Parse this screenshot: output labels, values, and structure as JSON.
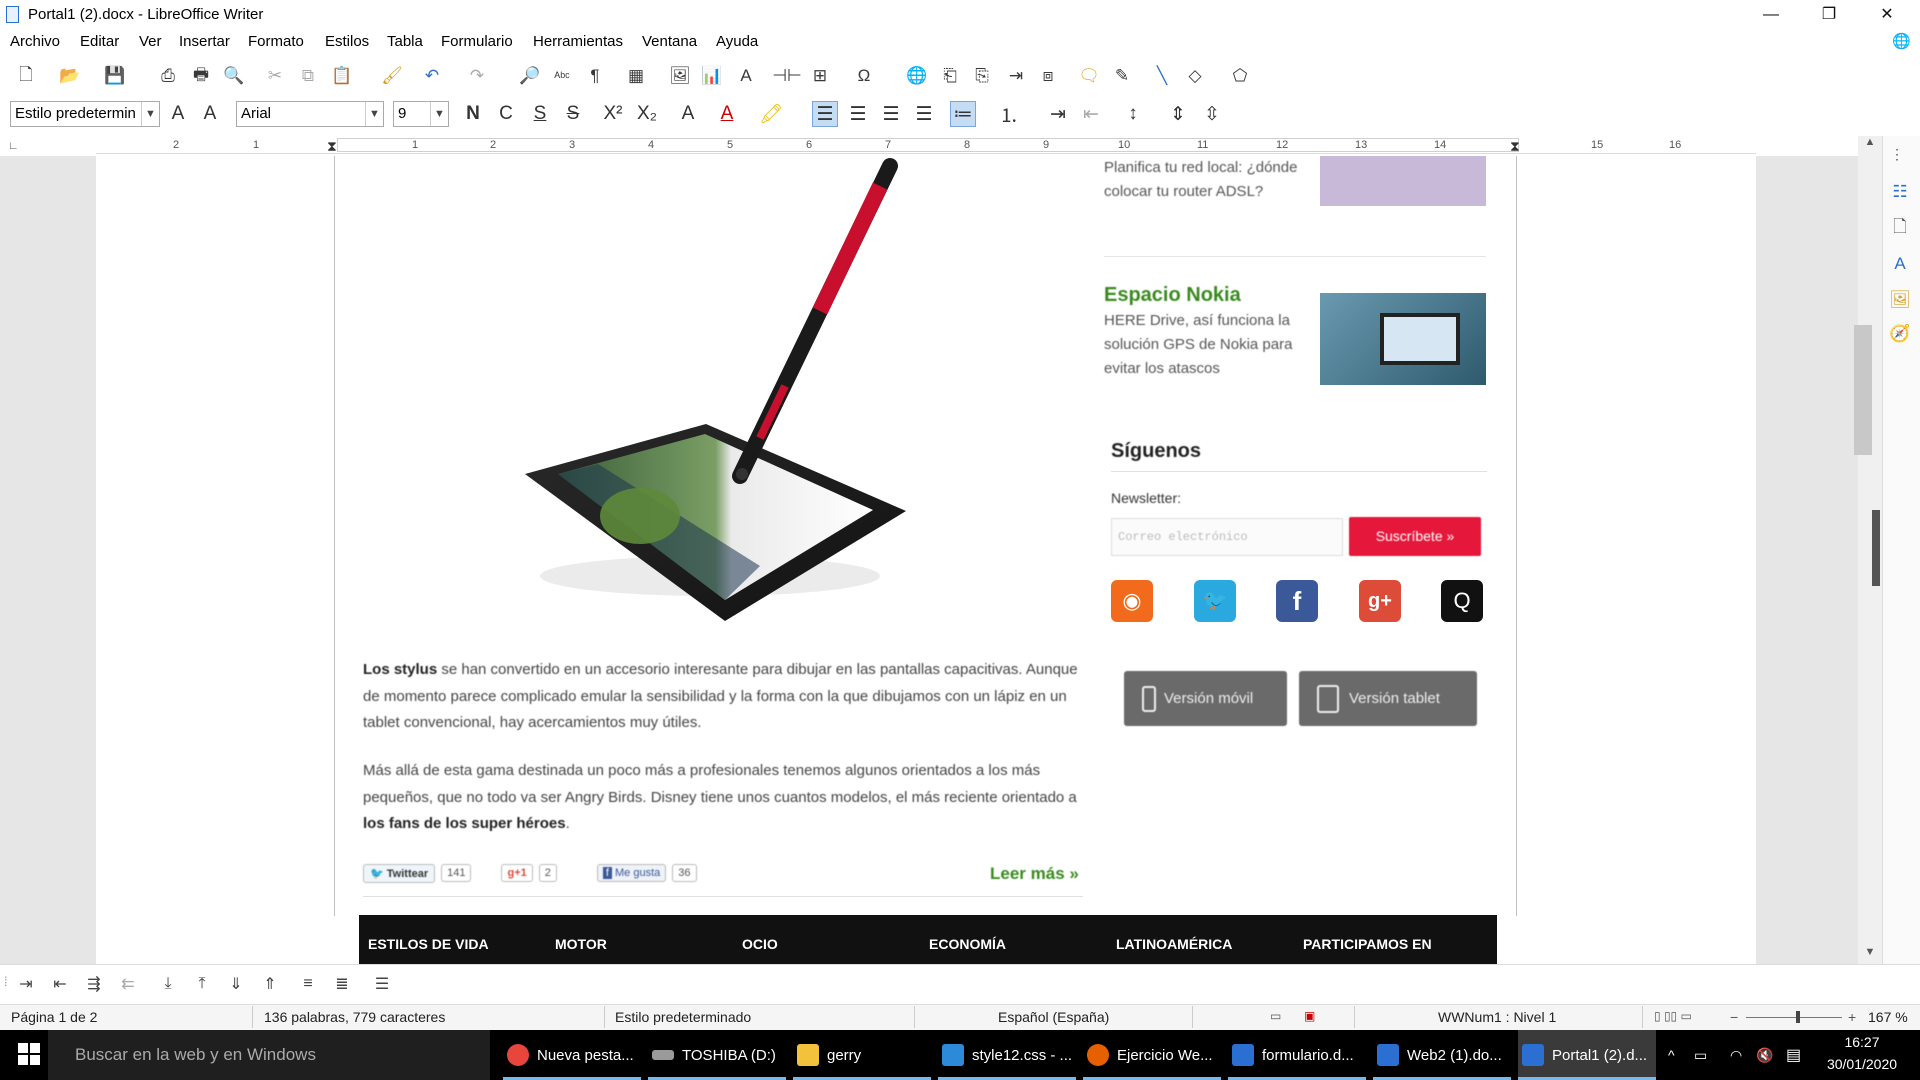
{
  "window": {
    "title": "Portal1 (2).docx - LibreOffice Writer"
  },
  "window_buttons": {
    "minimize": "—",
    "restore": "❐",
    "close": "✕"
  },
  "menu": [
    "Archivo",
    "Editar",
    "Ver",
    "Insertar",
    "Formato",
    "Estilos",
    "Tabla",
    "Formulario",
    "Herramientas",
    "Ventana",
    "Ayuda"
  ],
  "format_toolbar": {
    "paragraph_style": "Estilo predetermin",
    "font_name": "Arial",
    "font_size": "9",
    "bold": "N",
    "italic": "C",
    "underline": "S",
    "strike": "S",
    "superscript": "X²",
    "subscript": "X₂"
  },
  "ruler": {
    "numbers": [
      "2",
      "1",
      "1",
      "2",
      "3",
      "4",
      "5",
      "6",
      "7",
      "8",
      "9",
      "10",
      "11",
      "12",
      "13",
      "14",
      "15",
      "16",
      "17"
    ]
  },
  "document": {
    "sidebar_top": {
      "text": "Planifica tu red local: ¿dónde colocar tu router ADSL?"
    },
    "nokia": {
      "title": "Espacio Nokia",
      "desc": "HERE Drive, así funciona la solución GPS de Nokia para evitar los atascos"
    },
    "siguenos": {
      "title": "Síguenos",
      "newsletter": "Newsletter:",
      "email_placeholder": "Correo electrónico",
      "subscribe": "Suscríbete »"
    },
    "social": [
      {
        "name": "rss",
        "color": "#f26a1b",
        "glyph": "◉"
      },
      {
        "name": "twitter",
        "color": "#2aa9e0",
        "glyph": "🐦"
      },
      {
        "name": "facebook",
        "color": "#3b5998",
        "glyph": "f"
      },
      {
        "name": "google-plus",
        "color": "#dd4b39",
        "glyph": "g+"
      },
      {
        "name": "other",
        "color": "#111111",
        "glyph": "Q"
      }
    ],
    "version_mobile": "Versión móvil",
    "version_tablet": "Versión tablet",
    "paragraph1_bold": "Los stylus",
    "paragraph1_rest": " se han convertido en un accesorio interesante para dibujar en las pantallas capacitivas. Aunque de momento parece complicado emular la sensibilidad y la forma con la que dibujamos con un lápiz en un tablet convencional, hay acercamientos muy útiles.",
    "paragraph2_start": "Más allá de esta gama destinada un poco más a profesionales tenemos algunos orientados a los más pequeños, que no todo va ser Angry Birds. Disney tiene unos cuantos modelos, el más reciente orientado a ",
    "paragraph2_bold": "los fans de los super héroes",
    "paragraph2_end": ".",
    "share": {
      "twitter": "Twittear",
      "twitter_count": "141",
      "gplus": "+1",
      "gplus_count": "2",
      "fb": "Me gusta",
      "fb_count": "36"
    },
    "read_more": "Leer más »",
    "footer_nav": [
      "ESTILOS DE VIDA",
      "MOTOR",
      "OCIO",
      "ECONOMÍA",
      "LATINOAMÉRICA",
      "PARTICIPAMOS EN"
    ]
  },
  "status": {
    "page": "Página 1 de 2",
    "words": "136 palabras, 779 caracteres",
    "style": "Estilo predeterminado",
    "language": "Español (España)",
    "list": "WWNum1 : Nivel 1",
    "zoom": "167 %"
  },
  "taskbar": {
    "search": "Buscar en la web y en Windows",
    "apps": [
      {
        "label": "Nueva pesta...",
        "color": "#e8453c"
      },
      {
        "label": "TOSHIBA (D:)",
        "color": "#9a9a9a"
      },
      {
        "label": "gerry",
        "color": "#f3c13a"
      },
      {
        "label": "style12.css - ...",
        "color": "#2c8ad8"
      },
      {
        "label": "Ejercicio We...",
        "color": "#e66000"
      },
      {
        "label": "formulario.d...",
        "color": "#2a6fd1"
      },
      {
        "label": "Web2 (1).do...",
        "color": "#2a6fd1"
      },
      {
        "label": "Portal1 (2).d...",
        "color": "#2a6fd1"
      }
    ],
    "time": "16:27",
    "date": "30/01/2020"
  },
  "colors": {
    "accent": "#2a6fd1",
    "nokia_green": "#3a8a1e",
    "subscribe_red": "#e5173b"
  }
}
